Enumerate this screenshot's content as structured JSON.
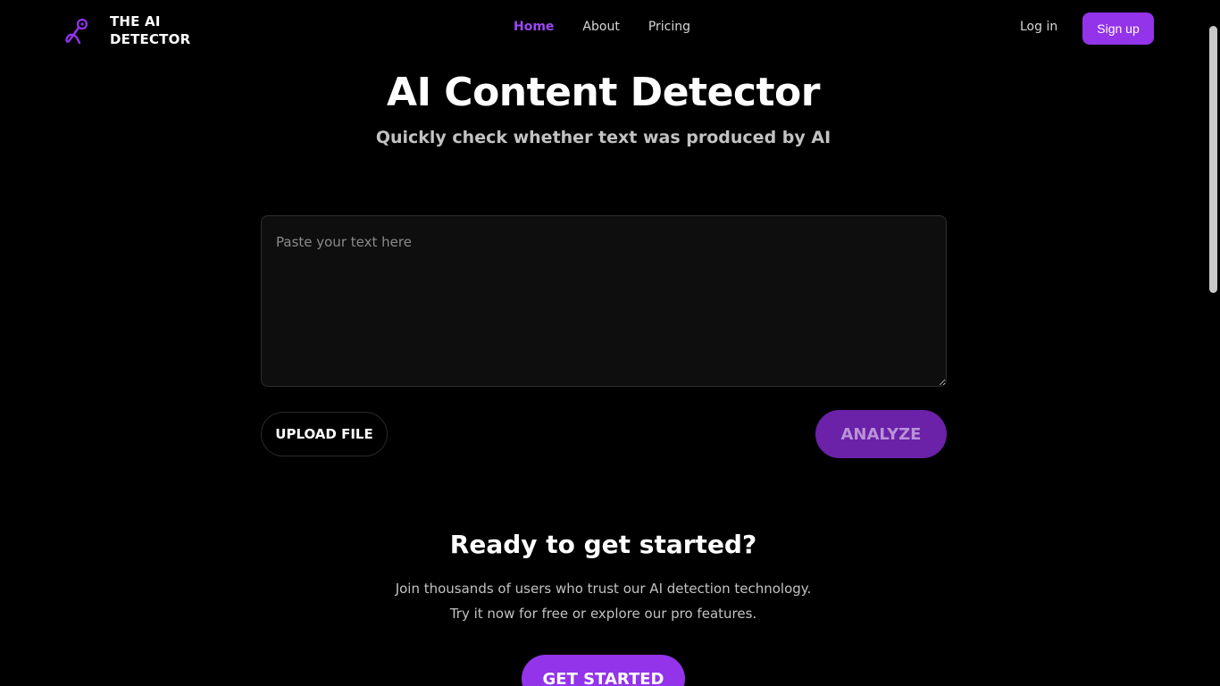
{
  "brand": {
    "name": "THE AI DETECTOR",
    "accent_color": "#9333ea",
    "icon": "magnifier-logo-icon"
  },
  "nav": {
    "items": [
      {
        "label": "Home",
        "active": true
      },
      {
        "label": "About",
        "active": false
      },
      {
        "label": "Pricing",
        "active": false
      }
    ],
    "login_label": "Log in",
    "signup_label": "Sign up"
  },
  "hero": {
    "title": "AI Content Detector",
    "subtitle": "Quickly check whether text was produced by AI"
  },
  "editor": {
    "placeholder": "Paste your text here",
    "value": "",
    "upload_label": "UPLOAD FILE",
    "analyze_label": "ANALYZE"
  },
  "cta": {
    "title": "Ready to get started?",
    "line1": "Join thousands of users who trust our AI detection technology.",
    "line2": "Try it now for free or explore our pro features.",
    "button_label": "GET STARTED"
  }
}
